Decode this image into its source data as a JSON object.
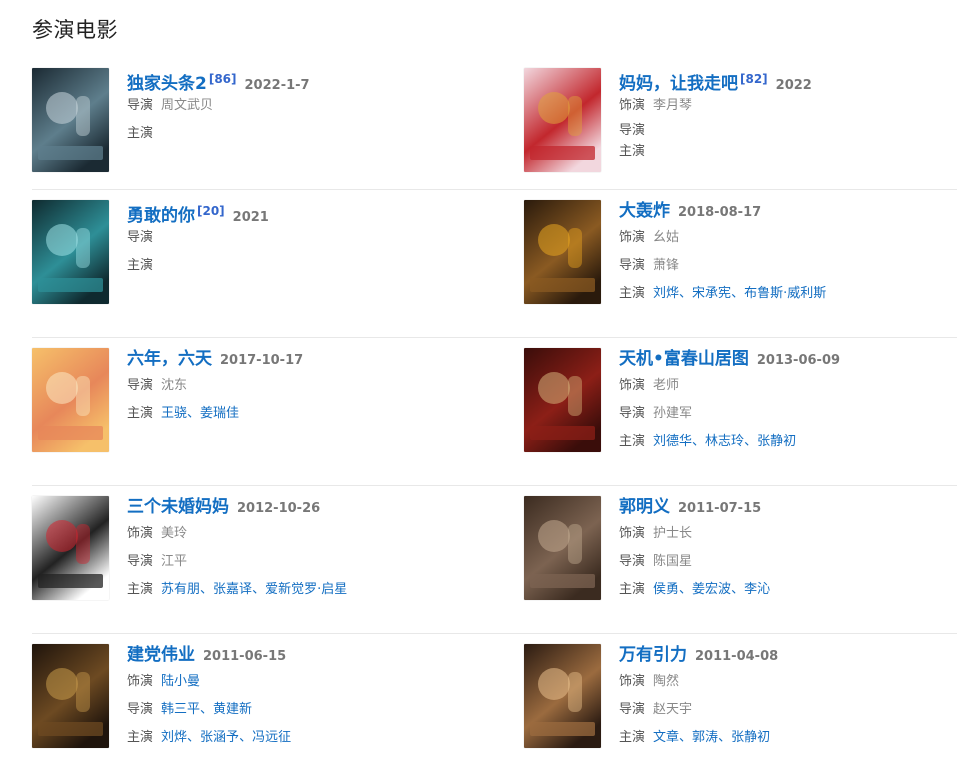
{
  "section_title": "参演电影",
  "films": [
    {
      "title": "独家头条2",
      "ref": "[86]",
      "date": "2022-1-7",
      "roles": [
        {
          "label": "导演",
          "names": [
            "周文武贝"
          ],
          "linked": false
        },
        {
          "label": "主演",
          "names": [],
          "linked": false
        }
      ],
      "poster_colors": [
        "#1b2a33",
        "#5e7e8c",
        "#c9d6dc"
      ]
    },
    {
      "title": "妈妈，让我走吧",
      "ref": "[82]",
      "date": "2022",
      "roles": [
        {
          "label": "饰演",
          "names": [
            "李月琴"
          ],
          "linked": false
        },
        {
          "label": "导演",
          "names": [],
          "linked": false
        },
        {
          "label": "主演",
          "names": [],
          "linked": false
        }
      ],
      "poster_colors": [
        "#f2d7de",
        "#c2272d",
        "#e0a33a"
      ]
    },
    {
      "title": "勇敢的你",
      "ref": "[20]",
      "date": "2021",
      "roles": [
        {
          "label": "导演",
          "names": [],
          "linked": false
        },
        {
          "label": "主演",
          "names": [],
          "linked": false
        }
      ],
      "poster_colors": [
        "#0f2a2f",
        "#2e8f97",
        "#9fe2e6"
      ]
    },
    {
      "title": "大轰炸",
      "ref": "",
      "date": "2018-08-17",
      "roles": [
        {
          "label": "饰演",
          "names": [
            "幺姑"
          ],
          "linked": false
        },
        {
          "label": "导演",
          "names": [
            "萧锋"
          ],
          "linked": false
        },
        {
          "label": "主演",
          "names": [
            "刘烨",
            "宋承宪",
            "布鲁斯·威利斯"
          ],
          "linked": true
        }
      ],
      "poster_colors": [
        "#2a1a0c",
        "#8a5a22",
        "#e8a520"
      ]
    },
    {
      "title": "六年，六天",
      "ref": "",
      "date": "2017-10-17",
      "roles": [
        {
          "label": "导演",
          "names": [
            "沈东"
          ],
          "linked": false
        },
        {
          "label": "主演",
          "names": [
            "王骁",
            "姜瑞佳"
          ],
          "linked": true
        }
      ],
      "poster_colors": [
        "#f6c06a",
        "#e7875a",
        "#fbe8c2"
      ]
    },
    {
      "title": "天机•富春山居图",
      "ref": "",
      "date": "2013-06-09",
      "roles": [
        {
          "label": "饰演",
          "names": [
            "老师"
          ],
          "linked": false
        },
        {
          "label": "导演",
          "names": [
            "孙建军"
          ],
          "linked": false
        },
        {
          "label": "主演",
          "names": [
            "刘德华",
            "林志玲",
            "张静初"
          ],
          "linked": true
        }
      ],
      "poster_colors": [
        "#3a0d0a",
        "#8c1f17",
        "#d6b37a"
      ]
    },
    {
      "title": "三个未婚妈妈",
      "ref": "",
      "date": "2012-10-26",
      "roles": [
        {
          "label": "饰演",
          "names": [
            "美玲"
          ],
          "linked": false
        },
        {
          "label": "导演",
          "names": [
            "江平"
          ],
          "linked": false
        },
        {
          "label": "主演",
          "names": [
            "苏有朋",
            "张嘉译",
            "爱新觉罗·启星"
          ],
          "linked": true
        }
      ],
      "poster_colors": [
        "#ffffff",
        "#222222",
        "#d3242f"
      ]
    },
    {
      "title": "郭明义",
      "ref": "",
      "date": "2011-07-15",
      "roles": [
        {
          "label": "饰演",
          "names": [
            "护士长"
          ],
          "linked": false
        },
        {
          "label": "导演",
          "names": [
            "陈国星"
          ],
          "linked": false
        },
        {
          "label": "主演",
          "names": [
            "侯勇",
            "姜宏波",
            "李沁"
          ],
          "linked": true
        }
      ],
      "poster_colors": [
        "#3b2b20",
        "#7c6351",
        "#c2aa90"
      ]
    },
    {
      "title": "建党伟业",
      "ref": "",
      "date": "2011-06-15",
      "roles": [
        {
          "label": "饰演",
          "names": [
            "陆小曼"
          ],
          "linked": true
        },
        {
          "label": "导演",
          "names": [
            "韩三平",
            "黄建新"
          ],
          "linked": true
        },
        {
          "label": "主演",
          "names": [
            "刘烨",
            "张涵予",
            "冯远征"
          ],
          "linked": true
        }
      ],
      "poster_colors": [
        "#1f140c",
        "#6d4a22",
        "#c79a4b"
      ]
    },
    {
      "title": "万有引力",
      "ref": "",
      "date": "2011-04-08",
      "roles": [
        {
          "label": "饰演",
          "names": [
            "陶然"
          ],
          "linked": false
        },
        {
          "label": "导演",
          "names": [
            "赵天宇"
          ],
          "linked": false
        },
        {
          "label": "主演",
          "names": [
            "文章",
            "郭涛",
            "张静初"
          ],
          "linked": true
        }
      ],
      "poster_colors": [
        "#2b1b12",
        "#9b6b3f",
        "#e9c08c"
      ]
    }
  ]
}
